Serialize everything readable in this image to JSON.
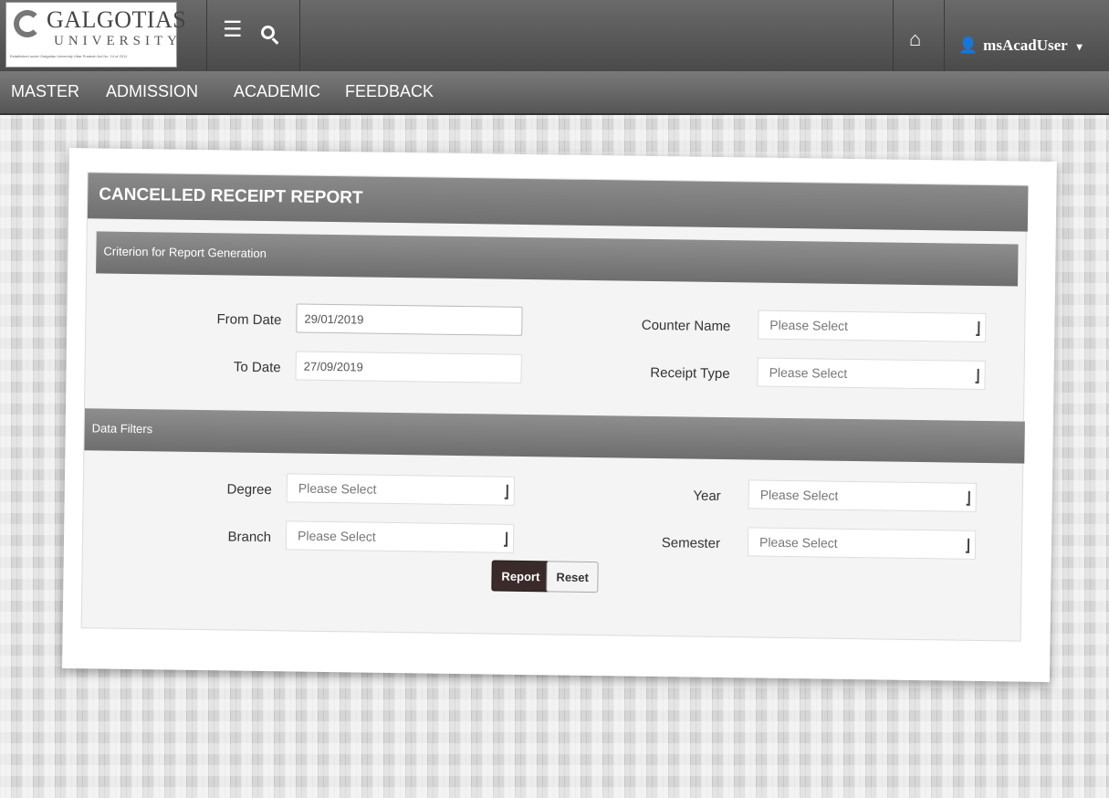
{
  "header": {
    "logo_name": "GALGOTIAS",
    "logo_sub": "UNIVERSITY",
    "logo_tagline": "Established under Galgotias University Uttar Pradesh Act No. 14 of 2011",
    "menu_icon": "hamburger-icon",
    "search_icon": "search-icon",
    "home_icon": "home-icon",
    "user_icon": "person-icon",
    "user_name": "msAcadUser",
    "user_caret": "▾"
  },
  "nav": {
    "items": [
      "MASTER",
      "ADMISSION",
      "ACADEMIC",
      "FEEDBACK"
    ]
  },
  "page": {
    "title": "CANCELLED RECEIPT REPORT"
  },
  "criteria": {
    "label": "Criterion for Report Generation",
    "from_date_label": "From Date",
    "from_date_value": "29/01/2019",
    "to_date_label": "To Date",
    "to_date_value": "27/09/2019",
    "counter_name_label": "Counter Name",
    "counter_name_value": "Please Select",
    "receipt_type_label": "Receipt Type",
    "receipt_type_value": "Please Select"
  },
  "filters": {
    "label": "Data Filters",
    "degree_label": "Degree",
    "degree_value": "Please Select",
    "branch_label": "Branch",
    "branch_value": "Please Select",
    "year_label": "Year",
    "year_value": "Please Select",
    "semester_label": "Semester",
    "semester_value": "Please Select"
  },
  "actions": {
    "report_label": "Report",
    "reset_label": "Reset"
  },
  "colors": {
    "header_bg": "#555555",
    "report_button": "#3a2a2a"
  }
}
